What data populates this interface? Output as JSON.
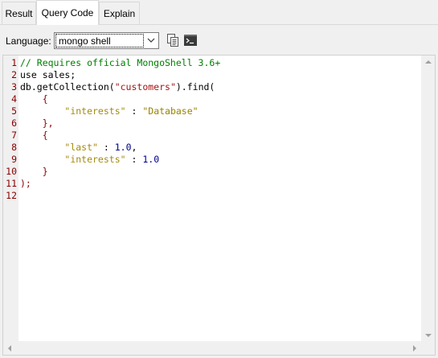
{
  "tabs": [
    {
      "label": "Result",
      "active": false
    },
    {
      "label": "Query Code",
      "active": true
    },
    {
      "label": "Explain",
      "active": false
    }
  ],
  "toolbar": {
    "language_label": "Language:",
    "language_value": "mongo shell",
    "icons": [
      "copy-icon",
      "mongo-shell-icon"
    ]
  },
  "editor": {
    "line_numbers": [
      "1",
      "2",
      "3",
      "4",
      "5",
      "6",
      "7",
      "8",
      "9",
      "10",
      "11",
      "12"
    ],
    "lines": [
      [
        {
          "t": "// Requires official MongoShell 3.6+",
          "c": "comment"
        }
      ],
      [
        {
          "t": "use sales;",
          "c": "kw"
        }
      ],
      [
        {
          "t": "db.getCollection(",
          "c": "kw"
        },
        {
          "t": "\"customers\"",
          "c": "str"
        },
        {
          "t": ").find(",
          "c": "kw"
        }
      ],
      [
        {
          "t": "    {",
          "c": "punct"
        }
      ],
      [
        {
          "t": "        ",
          "c": "kw"
        },
        {
          "t": "\"interests\"",
          "c": "key"
        },
        {
          "t": " : ",
          "c": "kw"
        },
        {
          "t": "\"Database\"",
          "c": "key2"
        }
      ],
      [
        {
          "t": "    },",
          "c": "punct"
        }
      ],
      [
        {
          "t": "    {",
          "c": "punct"
        }
      ],
      [
        {
          "t": "        ",
          "c": "kw"
        },
        {
          "t": "\"last\"",
          "c": "key"
        },
        {
          "t": " : ",
          "c": "kw"
        },
        {
          "t": "1.0",
          "c": "num"
        },
        {
          "t": ",",
          "c": "kw"
        }
      ],
      [
        {
          "t": "        ",
          "c": "kw"
        },
        {
          "t": "\"interests\"",
          "c": "key"
        },
        {
          "t": " : ",
          "c": "kw"
        },
        {
          "t": "1.0",
          "c": "num"
        }
      ],
      [
        {
          "t": "    }",
          "c": "punct"
        }
      ],
      [
        {
          "t": ");",
          "c": "punct"
        }
      ],
      []
    ]
  }
}
